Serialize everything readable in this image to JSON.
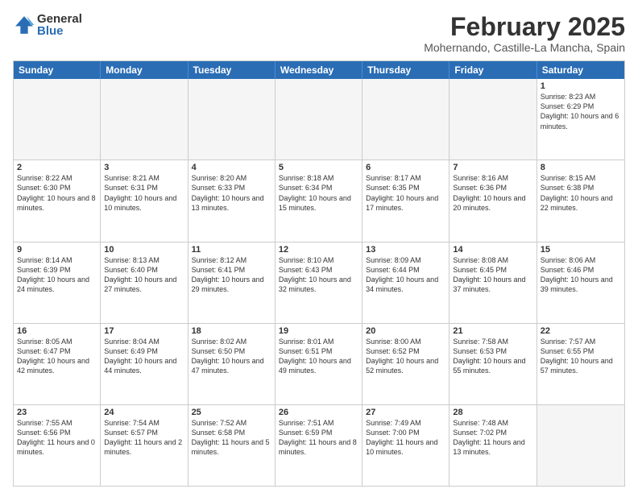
{
  "logo": {
    "general": "General",
    "blue": "Blue"
  },
  "title": "February 2025",
  "subtitle": "Mohernando, Castille-La Mancha, Spain",
  "headers": [
    "Sunday",
    "Monday",
    "Tuesday",
    "Wednesday",
    "Thursday",
    "Friday",
    "Saturday"
  ],
  "weeks": [
    [
      {
        "day": "",
        "info": ""
      },
      {
        "day": "",
        "info": ""
      },
      {
        "day": "",
        "info": ""
      },
      {
        "day": "",
        "info": ""
      },
      {
        "day": "",
        "info": ""
      },
      {
        "day": "",
        "info": ""
      },
      {
        "day": "1",
        "info": "Sunrise: 8:23 AM\nSunset: 6:29 PM\nDaylight: 10 hours and 6 minutes."
      }
    ],
    [
      {
        "day": "2",
        "info": "Sunrise: 8:22 AM\nSunset: 6:30 PM\nDaylight: 10 hours and 8 minutes."
      },
      {
        "day": "3",
        "info": "Sunrise: 8:21 AM\nSunset: 6:31 PM\nDaylight: 10 hours and 10 minutes."
      },
      {
        "day": "4",
        "info": "Sunrise: 8:20 AM\nSunset: 6:33 PM\nDaylight: 10 hours and 13 minutes."
      },
      {
        "day": "5",
        "info": "Sunrise: 8:18 AM\nSunset: 6:34 PM\nDaylight: 10 hours and 15 minutes."
      },
      {
        "day": "6",
        "info": "Sunrise: 8:17 AM\nSunset: 6:35 PM\nDaylight: 10 hours and 17 minutes."
      },
      {
        "day": "7",
        "info": "Sunrise: 8:16 AM\nSunset: 6:36 PM\nDaylight: 10 hours and 20 minutes."
      },
      {
        "day": "8",
        "info": "Sunrise: 8:15 AM\nSunset: 6:38 PM\nDaylight: 10 hours and 22 minutes."
      }
    ],
    [
      {
        "day": "9",
        "info": "Sunrise: 8:14 AM\nSunset: 6:39 PM\nDaylight: 10 hours and 24 minutes."
      },
      {
        "day": "10",
        "info": "Sunrise: 8:13 AM\nSunset: 6:40 PM\nDaylight: 10 hours and 27 minutes."
      },
      {
        "day": "11",
        "info": "Sunrise: 8:12 AM\nSunset: 6:41 PM\nDaylight: 10 hours and 29 minutes."
      },
      {
        "day": "12",
        "info": "Sunrise: 8:10 AM\nSunset: 6:43 PM\nDaylight: 10 hours and 32 minutes."
      },
      {
        "day": "13",
        "info": "Sunrise: 8:09 AM\nSunset: 6:44 PM\nDaylight: 10 hours and 34 minutes."
      },
      {
        "day": "14",
        "info": "Sunrise: 8:08 AM\nSunset: 6:45 PM\nDaylight: 10 hours and 37 minutes."
      },
      {
        "day": "15",
        "info": "Sunrise: 8:06 AM\nSunset: 6:46 PM\nDaylight: 10 hours and 39 minutes."
      }
    ],
    [
      {
        "day": "16",
        "info": "Sunrise: 8:05 AM\nSunset: 6:47 PM\nDaylight: 10 hours and 42 minutes."
      },
      {
        "day": "17",
        "info": "Sunrise: 8:04 AM\nSunset: 6:49 PM\nDaylight: 10 hours and 44 minutes."
      },
      {
        "day": "18",
        "info": "Sunrise: 8:02 AM\nSunset: 6:50 PM\nDaylight: 10 hours and 47 minutes."
      },
      {
        "day": "19",
        "info": "Sunrise: 8:01 AM\nSunset: 6:51 PM\nDaylight: 10 hours and 49 minutes."
      },
      {
        "day": "20",
        "info": "Sunrise: 8:00 AM\nSunset: 6:52 PM\nDaylight: 10 hours and 52 minutes."
      },
      {
        "day": "21",
        "info": "Sunrise: 7:58 AM\nSunset: 6:53 PM\nDaylight: 10 hours and 55 minutes."
      },
      {
        "day": "22",
        "info": "Sunrise: 7:57 AM\nSunset: 6:55 PM\nDaylight: 10 hours and 57 minutes."
      }
    ],
    [
      {
        "day": "23",
        "info": "Sunrise: 7:55 AM\nSunset: 6:56 PM\nDaylight: 11 hours and 0 minutes."
      },
      {
        "day": "24",
        "info": "Sunrise: 7:54 AM\nSunset: 6:57 PM\nDaylight: 11 hours and 2 minutes."
      },
      {
        "day": "25",
        "info": "Sunrise: 7:52 AM\nSunset: 6:58 PM\nDaylight: 11 hours and 5 minutes."
      },
      {
        "day": "26",
        "info": "Sunrise: 7:51 AM\nSunset: 6:59 PM\nDaylight: 11 hours and 8 minutes."
      },
      {
        "day": "27",
        "info": "Sunrise: 7:49 AM\nSunset: 7:00 PM\nDaylight: 11 hours and 10 minutes."
      },
      {
        "day": "28",
        "info": "Sunrise: 7:48 AM\nSunset: 7:02 PM\nDaylight: 11 hours and 13 minutes."
      },
      {
        "day": "",
        "info": ""
      }
    ]
  ]
}
